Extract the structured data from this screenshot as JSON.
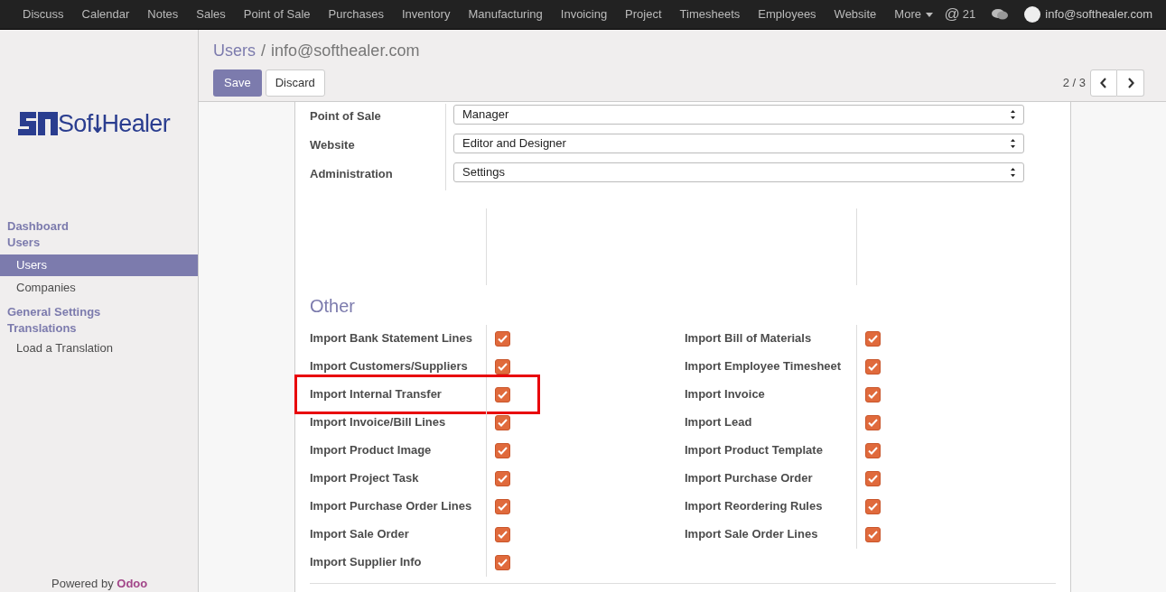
{
  "top_menu": [
    {
      "label": "Discuss"
    },
    {
      "label": "Calendar"
    },
    {
      "label": "Notes"
    },
    {
      "label": "Sales"
    },
    {
      "label": "Point of Sale"
    },
    {
      "label": "Purchases"
    },
    {
      "label": "Inventory"
    },
    {
      "label": "Manufacturing"
    },
    {
      "label": "Invoicing"
    },
    {
      "label": "Project"
    },
    {
      "label": "Timesheets"
    },
    {
      "label": "Employees"
    },
    {
      "label": "Website"
    },
    {
      "label": "More"
    }
  ],
  "systray": {
    "mentions_symbol": "@",
    "mentions": "21",
    "user": "info@softhealer.com"
  },
  "sidebar": {
    "logo": {
      "prefix": "Sof",
      "suffix": "Healer"
    },
    "sections": [
      {
        "title": "Dashboard"
      },
      {
        "title": "Users",
        "items": [
          {
            "label": "Users",
            "selected": true
          },
          {
            "label": "Companies",
            "selected": false
          }
        ]
      },
      {
        "title": "General Settings"
      },
      {
        "title": "Translations",
        "items": [
          {
            "label": "Load a Translation",
            "selected": false
          }
        ]
      }
    ],
    "footer": {
      "text": "Powered by",
      "brand": "Odoo"
    }
  },
  "breadcrumb": {
    "parent": "Users",
    "separator": "/",
    "current": "info@softhealer.com"
  },
  "buttons": {
    "save": "Save",
    "discard": "Discard"
  },
  "pager": {
    "value": "2 / 3"
  },
  "access_rights": [
    {
      "label": "Point of Sale",
      "value": "Manager"
    },
    {
      "label": "Website",
      "value": "Editor and Designer"
    },
    {
      "label": "Administration",
      "value": "Settings"
    }
  ],
  "other": {
    "title": "Other",
    "left": [
      {
        "label": "Import Bank Statement Lines",
        "checked": true,
        "highlighted": false
      },
      {
        "label": "Import Customers/Suppliers",
        "checked": true,
        "highlighted": false
      },
      {
        "label": "Import Internal Transfer",
        "checked": true,
        "highlighted": true
      },
      {
        "label": "Import Invoice/Bill Lines",
        "checked": true,
        "highlighted": false
      },
      {
        "label": "Import Product Image",
        "checked": true,
        "highlighted": false
      },
      {
        "label": "Import Project Task",
        "checked": true,
        "highlighted": false
      },
      {
        "label": "Import Purchase Order Lines",
        "checked": true,
        "highlighted": false
      },
      {
        "label": "Import Sale Order",
        "checked": true,
        "highlighted": false
      },
      {
        "label": "Import Supplier Info",
        "checked": true,
        "highlighted": false
      }
    ],
    "right": [
      {
        "label": "Import Bill of Materials",
        "checked": true,
        "highlighted": false
      },
      {
        "label": "Import Employee Timesheet",
        "checked": true,
        "highlighted": false
      },
      {
        "label": "Import Invoice",
        "checked": true,
        "highlighted": false
      },
      {
        "label": "Import Lead",
        "checked": true,
        "highlighted": false
      },
      {
        "label": "Import Product Template",
        "checked": true,
        "highlighted": false
      },
      {
        "label": "Import Purchase Order",
        "checked": true,
        "highlighted": false
      },
      {
        "label": "Import Reordering Rules",
        "checked": true,
        "highlighted": false
      },
      {
        "label": "Import Sale Order Lines",
        "checked": true,
        "highlighted": false
      }
    ]
  }
}
